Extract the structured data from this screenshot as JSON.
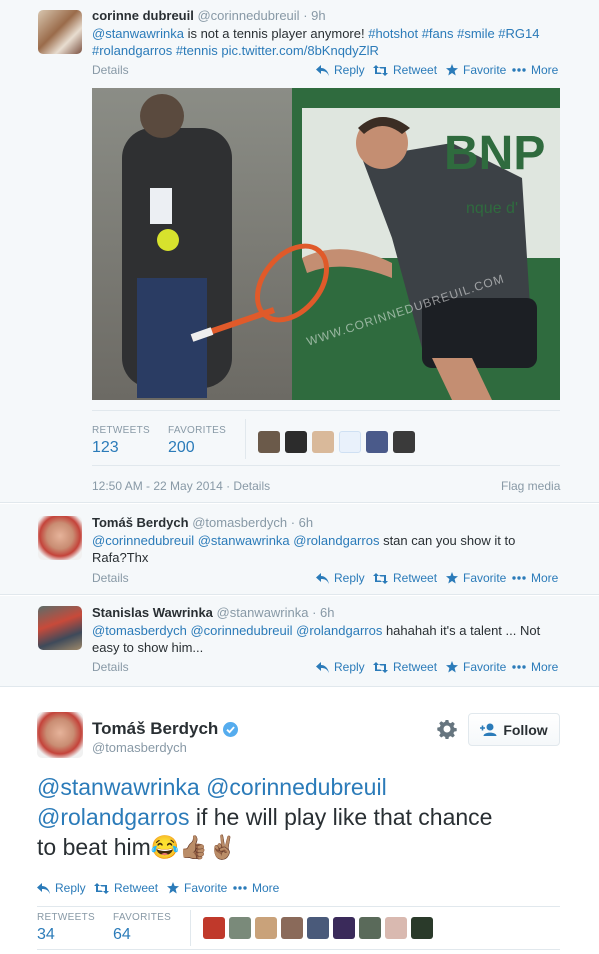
{
  "tweet1": {
    "name": "corinne dubreuil",
    "handle": "@corinnedubreuil",
    "time": "· 9h",
    "text_mention": "@stanwawrinka",
    "text_plain": " is not a tennis player anymore! ",
    "hashtags1": "#hotshot #fans #smile #RG14",
    "hashtags2": "#rolandgarros #tennis",
    "pic_link": "pic.twitter.com/8bKnqdyZlR",
    "details": "Details",
    "reply": "Reply",
    "retweet": "Retweet",
    "favorite": "Favorite",
    "more": "More",
    "photo_banner": "BNP P",
    "photo_banner_sub": "nque d'",
    "photo_watermark": "WWW.CORINNEDUBREUIL.COM",
    "retweets_label": "RETWEETS",
    "retweets_count": "123",
    "favorites_label": "FAVORITES",
    "favorites_count": "200",
    "timestamp": "12:50 AM - 22 May 2014",
    "timestamp_details": "· Details",
    "flag_media": "Flag media"
  },
  "reply1": {
    "name": "Tomáš Berdych",
    "handle": "@tomasberdych",
    "time": "· 6h",
    "mentions": "@corinnedubreuil @stanwawrinka @rolandgarros",
    "text_line1": " stan can you show it to",
    "text_line2": "Rafa?Thx",
    "details": "Details",
    "reply": "Reply",
    "retweet": "Retweet",
    "favorite": "Favorite",
    "more": "More"
  },
  "reply2": {
    "name": "Stanislas Wawrinka",
    "handle": "@stanwawrinka",
    "time": "· 6h",
    "mentions": "@tomasberdych @corinnedubreuil @rolandgarros",
    "text_line1": " hahahah it's a talent ... Not",
    "text_line2": "easy to show him...",
    "details": "Details",
    "reply": "Reply",
    "retweet": "Retweet",
    "favorite": "Favorite",
    "more": "More"
  },
  "main": {
    "name": "Tomáš Berdych",
    "handle": "@tomasberdych",
    "follow": "Follow",
    "line1": "@stanwawrinka @corinnedubreuil",
    "line2_mention": "@rolandgarros",
    "line2_text": " if he will play like that chance",
    "line3_text": "to beat him",
    "emoji": "😂👍🏽✌🏽",
    "reply": "Reply",
    "retweet": "Retweet",
    "favorite": "Favorite",
    "more": "More",
    "retweets_label": "RETWEETS",
    "retweets_count": "34",
    "favorites_label": "FAVORITES",
    "favorites_count": "64"
  },
  "colors": {
    "link": "#2b7bb9",
    "muted": "#8899a6",
    "verified": "#55acee"
  }
}
